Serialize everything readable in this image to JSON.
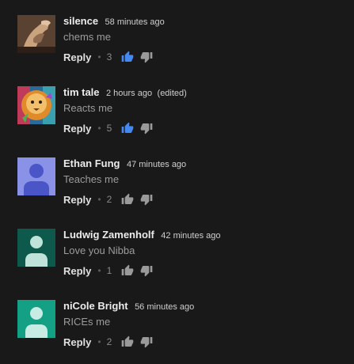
{
  "colors": {
    "background": "#191919",
    "like_active": "#4688f2",
    "like_inactive": "#9a9a9a"
  },
  "comments": [
    {
      "author": "silence",
      "time": "58 minutes ago",
      "edited": "",
      "text": "chems me",
      "reply_label": "Reply",
      "separator": "•",
      "likes": "3",
      "liked": true,
      "avatar": "photo-icon"
    },
    {
      "author": "tim tale",
      "time": "2 hours ago",
      "edited": "(edited)",
      "text": "Reacts me",
      "reply_label": "Reply",
      "separator": "•",
      "likes": "5",
      "liked": true,
      "avatar": "lion-photo-icon"
    },
    {
      "author": "Ethan Fung",
      "time": "47 minutes ago",
      "edited": "",
      "text": "Teaches me",
      "reply_label": "Reply",
      "separator": "•",
      "likes": "2",
      "liked": false,
      "avatar": "default-user-icon"
    },
    {
      "author": "Ludwig Zamenholf",
      "time": "42 minutes ago",
      "edited": "",
      "text": "Love you Nibba",
      "reply_label": "Reply",
      "separator": "•",
      "likes": "1",
      "liked": false,
      "avatar": "default-user-icon"
    },
    {
      "author": "niCole Bright",
      "time": "56 minutes ago",
      "edited": "",
      "text": "RICEs me",
      "reply_label": "Reply",
      "separator": "•",
      "likes": "2",
      "liked": false,
      "avatar": "default-user-icon"
    }
  ]
}
